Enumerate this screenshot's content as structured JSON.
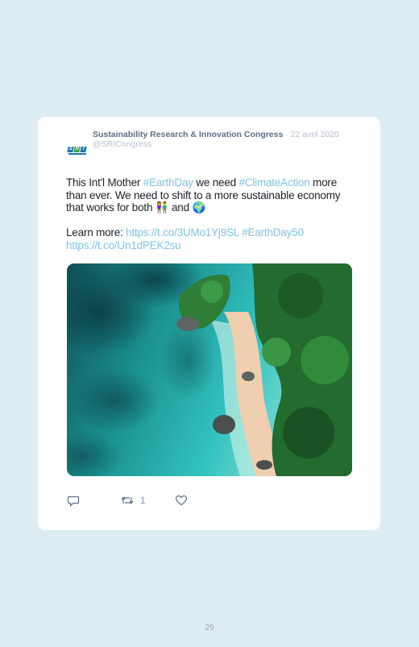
{
  "tweet": {
    "author_name": "Sustainability Research & Innovation Congress",
    "date": "· 22 avril 2020",
    "handle": "@SRICongress",
    "avatar_logo_letters": [
      "S",
      "R",
      "I"
    ],
    "text": {
      "p1": "This Int'l Mother ",
      "tag_earthday": "#EarthDay",
      "p2": " we need ",
      "tag_climate": "#ClimateAction",
      "p3": " more than ever. We need to shift to a more sustainable economy that works for both ",
      "emoji_people": "👫",
      "p4": " and ",
      "emoji_earth": "🌍",
      "learn_more": "Learn more: ",
      "link1": "https://t.co/3UMo1Yj9SL",
      "tag_earthday50": "#EarthDay50",
      "link2": "https://t.co/Un1dPEK2su"
    },
    "image_icon": "aerial-coastline-photo",
    "actions": {
      "reply_icon": "reply-icon",
      "retweet_icon": "retweet-icon",
      "retweet_count": "1",
      "like_icon": "heart-icon"
    }
  },
  "page_number": "29",
  "colors": {
    "background": "#deecf4",
    "card": "#ffffff",
    "link": "#7fc3ea",
    "name": "#5b6f87",
    "muted": "#b6bfcc"
  }
}
